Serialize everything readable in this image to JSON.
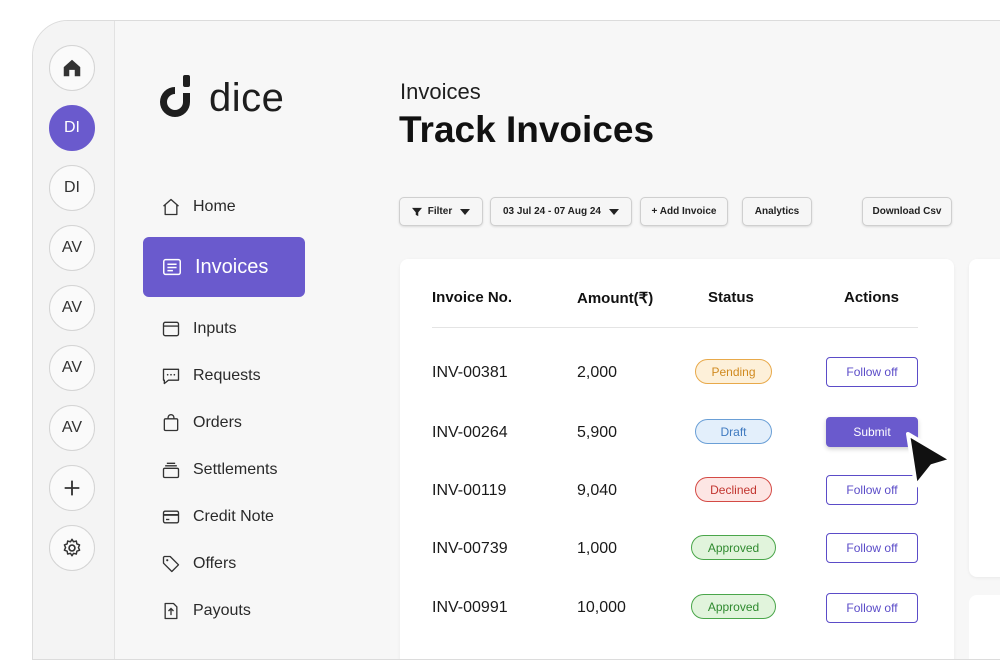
{
  "rail": {
    "items": [
      {
        "icon": "home-icon",
        "label": ""
      },
      {
        "icon": "",
        "label": "DI",
        "active": true
      },
      {
        "icon": "",
        "label": "DI"
      },
      {
        "icon": "",
        "label": "AV"
      },
      {
        "icon": "",
        "label": "AV"
      },
      {
        "icon": "",
        "label": "AV"
      },
      {
        "icon": "",
        "label": "AV"
      },
      {
        "icon": "plus-icon",
        "label": ""
      },
      {
        "icon": "settings-icon",
        "label": ""
      }
    ]
  },
  "brand": {
    "name": "dice"
  },
  "nav": {
    "items": [
      {
        "label": "Home",
        "icon": "home-outline-icon"
      },
      {
        "label": "Invoices",
        "icon": "invoice-icon",
        "active": true
      },
      {
        "label": "Inputs",
        "icon": "inputs-icon"
      },
      {
        "label": "Requests",
        "icon": "chat-icon"
      },
      {
        "label": "Orders",
        "icon": "bag-icon"
      },
      {
        "label": "Settlements",
        "icon": "stack-icon"
      },
      {
        "label": "Credit Note",
        "icon": "card-icon"
      },
      {
        "label": "Offers",
        "icon": "tag-icon"
      },
      {
        "label": "Payouts",
        "icon": "payout-icon"
      }
    ]
  },
  "header": {
    "breadcrumb": "Invoices",
    "title": "Track Invoices"
  },
  "toolbar": {
    "filter_label": "Filter",
    "date_range": "03 Jul 24 - 07 Aug 24",
    "add_invoice_label": "+ Add Invoice",
    "analytics_label": "Analytics",
    "download_label": "Download Csv"
  },
  "table": {
    "columns": [
      "Invoice No.",
      "Amount(₹)",
      "Status",
      "Actions"
    ],
    "rows": [
      {
        "invoice": "INV-00381",
        "amount": "2,000",
        "status": "Pending",
        "action": "Follow off"
      },
      {
        "invoice": "INV-00264",
        "amount": "5,900",
        "status": "Draft",
        "action": "Submit"
      },
      {
        "invoice": "INV-00119",
        "amount": "9,040",
        "status": "Declined",
        "action": "Follow off"
      },
      {
        "invoice": "INV-00739",
        "amount": "1,000",
        "status": "Approved",
        "action": "Follow off"
      },
      {
        "invoice": "INV-00991",
        "amount": "10,000",
        "status": "Approved",
        "action": "Follow off"
      }
    ]
  },
  "colors": {
    "accent": "#6a5acd",
    "pending": "#e8a94a",
    "draft": "#6a9fd6",
    "declined": "#d44a45",
    "approved": "#4aa64a"
  }
}
